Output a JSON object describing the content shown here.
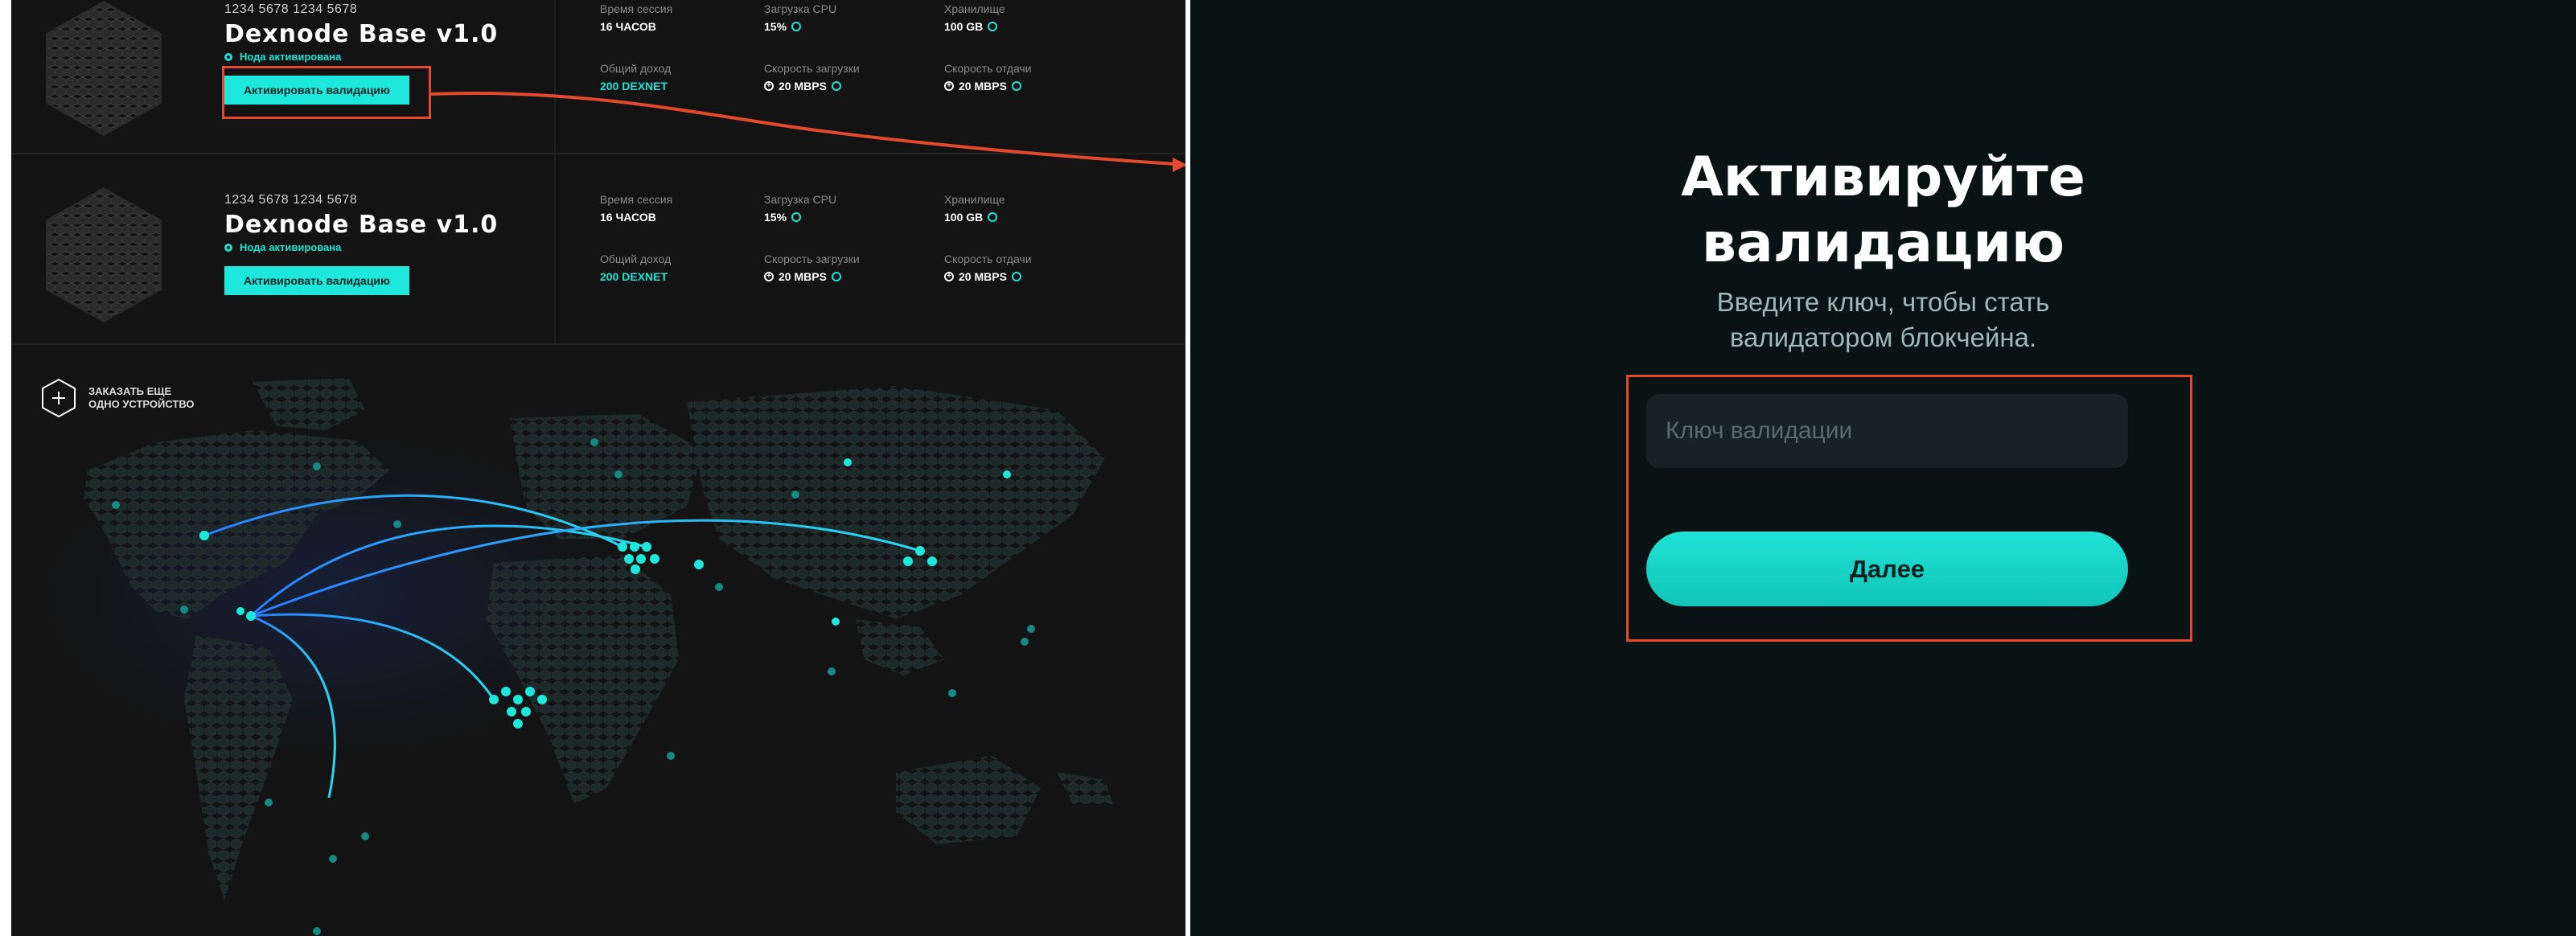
{
  "nodes": [
    {
      "serial": "1234 5678 1234 5678",
      "model": "Dexnode Base v1.0",
      "status": "Нода активирована",
      "activate_label": "Активировать валидацию",
      "session_label": "Время сессия",
      "session_value": "16 ЧАСОВ",
      "cpu_label": "Загрузка CPU",
      "cpu_value": "15%",
      "storage_label": "Хранилище",
      "storage_value": "100 GB",
      "income_label": "Общий доход",
      "income_value": "200 DEXNET",
      "download_label": "Скорость загрузки",
      "download_value": "20 MBPS",
      "upload_label": "Скорость отдачи",
      "upload_value": "20 MBPS"
    },
    {
      "serial": "1234 5678 1234 5678",
      "model": "Dexnode Base v1.0",
      "status": "Нода активирована",
      "activate_label": "Активировать валидацию",
      "session_label": "Время сессия",
      "session_value": "16 ЧАСОВ",
      "cpu_label": "Загрузка CPU",
      "cpu_value": "15%",
      "storage_label": "Хранилище",
      "storage_value": "100 GB",
      "income_label": "Общий доход",
      "income_value": "200 DEXNET",
      "download_label": "Скорость загрузки",
      "download_value": "20 MBPS",
      "upload_label": "Скорость отдачи",
      "upload_value": "20 MBPS"
    }
  ],
  "order_more": {
    "line1": "ЗАКАЗАТЬ ЕЩЕ",
    "line2": "ОДНО УСТРОЙСТВО"
  },
  "modal": {
    "title_line1": "Активируйте",
    "title_line2": "валидацию",
    "subtitle_line1": "Введите ключ, чтобы стать",
    "subtitle_line2": "валидатором блокчейна.",
    "input_placeholder": "Ключ валидации",
    "input_value": "",
    "next_label": "Далее"
  },
  "colors": {
    "accent": "#1ee8dc",
    "annotation": "#e2492d",
    "left_bg": "#131313",
    "right_bg": "#0a1314"
  }
}
